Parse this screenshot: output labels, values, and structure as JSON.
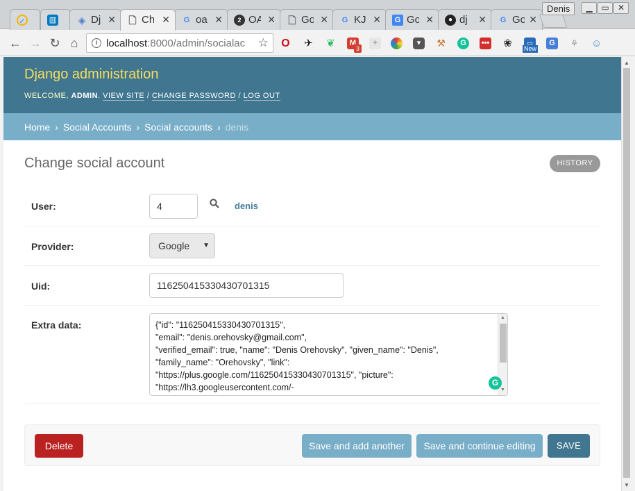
{
  "browser": {
    "tabs": [
      {
        "title": "",
        "icon": "gmail-reminder-icon",
        "color": "#f4b400"
      },
      {
        "title": "",
        "icon": "trello-icon",
        "color": "#0079bf"
      },
      {
        "title": "Dj",
        "icon": "stack-icon",
        "color": "#4a7bd0"
      },
      {
        "title": "Ch",
        "icon": "page-icon",
        "color": "#777777",
        "active": true
      },
      {
        "title": "oa",
        "icon": "google-icon",
        "color": "#4285f4"
      },
      {
        "title": "OA",
        "icon": "oauth-icon",
        "color": "#333333"
      },
      {
        "title": "Go",
        "icon": "page-icon",
        "color": "#777777"
      },
      {
        "title": "KJ",
        "icon": "google-icon",
        "color": "#4285f4"
      },
      {
        "title": "Go",
        "icon": "google-docs-icon",
        "color": "#4285f4"
      },
      {
        "title": "dj",
        "icon": "github-icon",
        "color": "#222222"
      },
      {
        "title": "Go",
        "icon": "google-icon",
        "color": "#4285f4"
      }
    ],
    "profile_name": "Denis",
    "url_host": "localhost",
    "url_rest": ":8000/admin/socialac",
    "extension_badge": "3",
    "new_badge": "New"
  },
  "admin": {
    "site_title": "Django administration",
    "welcome": "Welcome,",
    "username": "admin",
    "view_site": "View site",
    "change_password": "Change password",
    "logout": "Log out",
    "sep": "/"
  },
  "breadcrumbs": {
    "home": "Home",
    "app": "Social Accounts",
    "model": "Social accounts",
    "current": "denis",
    "sep": "›"
  },
  "page": {
    "title": "Change social account",
    "history": "History"
  },
  "form": {
    "user_label": "User:",
    "user_value": "4",
    "user_link": "denis",
    "provider_label": "Provider:",
    "provider_value": "Google",
    "uid_label": "Uid:",
    "uid_value": "116250415330430701315",
    "extra_label": "Extra data:",
    "extra_value": "{\"id\": \"116250415330430701315\",\n\"email\": \"denis.orehovsky@gmail.com\",\n\"verified_email\": true, \"name\": \"Denis Orehovsky\", \"given_name\": \"Denis\",\n\"family_name\": \"Orehovsky\", \"link\":\n\"https://plus.google.com/116250415330430701315\", \"picture\":\n\"https://lh3.googleusercontent.com/-"
  },
  "submit": {
    "delete": "Delete",
    "save_add": "Save and add another",
    "save_continue": "Save and continue editing",
    "save": "Save"
  },
  "colors": {
    "header": "#417690",
    "breadcrumbs": "#79aec8",
    "brand_yellow": "#f5dd5d",
    "delete_red": "#ba2121"
  }
}
